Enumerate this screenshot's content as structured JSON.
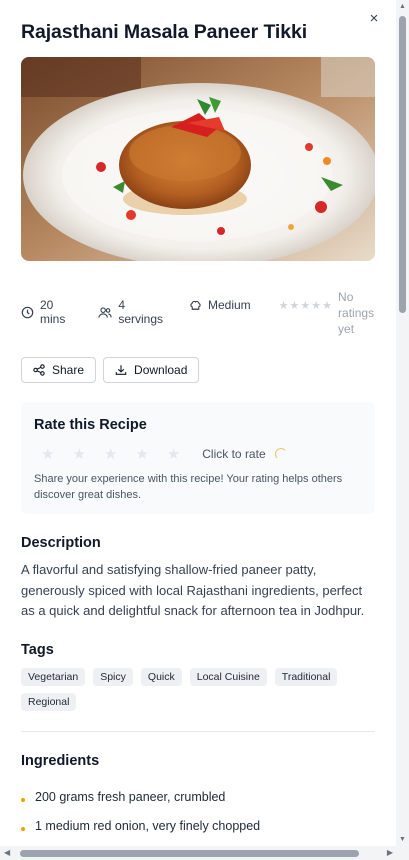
{
  "recipe": {
    "title": "Rajasthani Masala Paneer Tikki",
    "meta": {
      "time": "20 mins",
      "servings": "4 servings",
      "difficulty": "Medium",
      "rating_text": "No ratings yet"
    },
    "actions": {
      "share_label": "Share",
      "download_label": "Download"
    },
    "rate": {
      "title": "Rate this Recipe",
      "click_label": "Click to rate",
      "hint": "Share your experience with this recipe! Your rating helps others discover great dishes."
    },
    "description": {
      "title": "Description",
      "text": "A flavorful and satisfying shallow-fried paneer patty, generously spiced with local Rajasthani ingredients, perfect as a quick and delightful snack for afternoon tea in Jodhpur."
    },
    "tags": {
      "title": "Tags",
      "items": [
        "Vegetarian",
        "Spicy",
        "Quick",
        "Local Cuisine",
        "Traditional",
        "Regional"
      ]
    },
    "ingredients": {
      "title": "Ingredients",
      "items": [
        "200 grams fresh paneer, crumbled",
        "1 medium red onion, very finely chopped"
      ]
    },
    "close_glyph": "×",
    "colors": {
      "accent": "#f59e0b",
      "star_empty": "#e5e7eb",
      "card_bg": "#f8fafc"
    }
  }
}
